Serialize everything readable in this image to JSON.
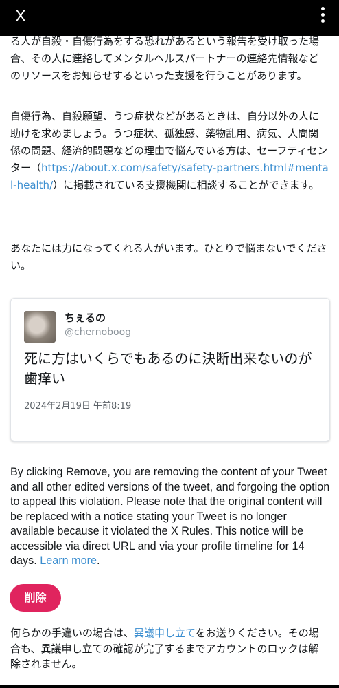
{
  "header": {
    "close_icon": "close-x-icon",
    "more_icon": "more-vertical-icon"
  },
  "paragraphs": {
    "p1": "る人が自殺・自傷行為をする恐れがあるという報告を受け取った場合、その人に連絡してメンタルヘルスパートナーの連絡先情報などのリソースをお知らせするといった支援を行うことがあります。",
    "p2_before": "自傷行為、自殺願望、うつ症状などがあるときは、自分以外の人に助けを求めましょう。うつ症状、孤独感、薬物乱用、病気、人間関係の問題、経済的問題などの理由で悩んでいる方は、セーフティセンター（",
    "p2_link": "https://about.x.com/safety/safety-partners.html#mental-health/",
    "p2_after": "）に掲載されている支援機関に相談することができます。",
    "p3": "あなたには力になってくれる人がいます。ひとりで悩まないでください。"
  },
  "tweet_card": {
    "display_name": "ちぇるの",
    "handle": "@chernoboog",
    "text": "死に方はいくらでもあるのに決断出来ないのが歯痒い",
    "timestamp": "2024年2月19日 午前8:19"
  },
  "notice": {
    "text": "By clicking Remove, you are removing the content of your Tweet and all other edited versions of the tweet, and forgoing the option to appeal this violation. Please note that the original content will be replaced with a notice stating your Tweet is no longer available because it violated the X Rules. This notice will be accessible via direct URL and via your profile timeline for 14 days.",
    "learn_more": "Learn more",
    "period": "."
  },
  "remove_button": "削除",
  "appeal": {
    "before": "何らかの手違いの場合は、",
    "link": "異議申し立て",
    "after": "をお送りください。その場合も、異議申し立ての確認が完了するまでアカウントのロックは解除されません。"
  },
  "colors": {
    "accent_link": "#3b8ed0",
    "remove_button": "#e0245e",
    "header_bg": "#000000"
  }
}
